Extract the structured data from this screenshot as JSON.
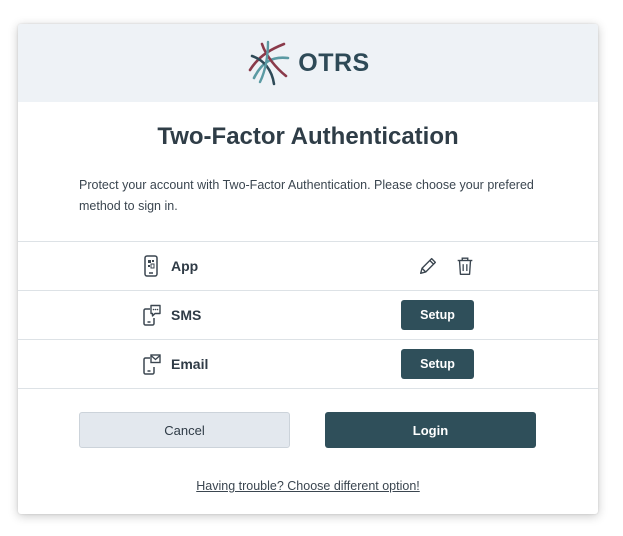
{
  "header": {
    "logo_text": "OTRS",
    "logo_colors": [
      "#8a3a4a",
      "#5b9aa3",
      "#2e4a57"
    ]
  },
  "title": "Two-Factor Authentication",
  "description": "Protect your account with Two-Factor Authentication. Please choose your prefered method to sign in.",
  "methods": [
    {
      "label": "App",
      "icon": "mobile-app-icon",
      "actions": [
        "edit-icon",
        "trash-icon"
      ]
    },
    {
      "label": "SMS",
      "icon": "sms-phone-icon",
      "button": "Setup"
    },
    {
      "label": "Email",
      "icon": "email-phone-icon",
      "button": "Setup"
    }
  ],
  "buttons": {
    "cancel": "Cancel",
    "login": "Login"
  },
  "trouble_link": "Having trouble? Choose different option!",
  "colors": {
    "primary": "#2f4f5a",
    "header_bg": "#eef2f6",
    "secondary_bg": "#e3e8ee"
  }
}
